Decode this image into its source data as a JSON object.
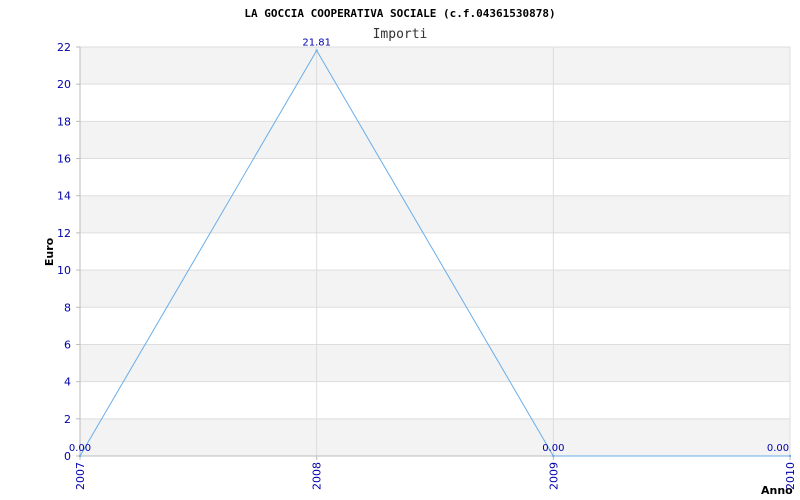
{
  "chart_data": {
    "type": "line",
    "title": "LA GOCCIA COOPERATIVA SOCIALE (c.f.04361530878)",
    "subtitle": "Importi",
    "xlabel": "Anno",
    "ylabel": "Euro",
    "x": [
      "2007",
      "2008",
      "2009",
      "2010"
    ],
    "series": [
      {
        "values": [
          0,
          21.81,
          0,
          0
        ]
      }
    ],
    "data_labels": [
      "0.00",
      "21.81",
      "0.00",
      "0.00"
    ],
    "ylim": [
      0,
      22
    ],
    "yticks": [
      0,
      2,
      4,
      6,
      8,
      10,
      12,
      14,
      16,
      18,
      20,
      22
    ],
    "grid": true,
    "line_color": "#6aaee8",
    "tick_color": "#0000aa",
    "band_color": "#f3f3f3"
  }
}
